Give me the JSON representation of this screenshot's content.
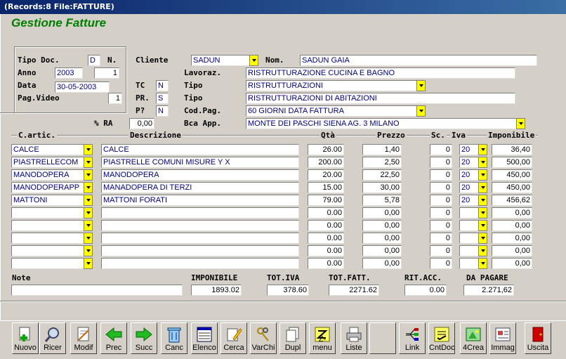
{
  "window": {
    "title": "(Records:8          File:FATTURE)"
  },
  "app_title": "Gestione Fatture",
  "header": {
    "tipo_doc_label": "Tipo Doc.",
    "tipo_doc_value": "D",
    "n_label": "N.",
    "anno_label": "Anno",
    "anno_value": "2003",
    "numero_value": "1",
    "data_label": "Data",
    "data_value": "30-05-2003",
    "pag_video_label": "Pag.Video",
    "pag_video_value": "1",
    "cliente_label": "Cliente",
    "cliente_value": "SADUN",
    "nom_label": "Nom.",
    "nom_value": "SADUN  GAIA",
    "lavoraz_label": "Lavoraz.",
    "lavoraz_value": "RISTRUTTURAZIONE CUCINA E BAGNO",
    "tc_label": "TC",
    "tc_value": "N",
    "tipo1_label": "Tipo",
    "tipo1_value": "RISTRUTTURAZIONI",
    "pr_label": "PR.",
    "pr_value": "S",
    "tipo2_label": "Tipo",
    "tipo2_value": "RISTRUTTURAZIONI DI ABITAZIONI",
    "p_label": "P?",
    "p_value": "N",
    "codpag_label": "Cod.Pag.",
    "codpag_value": "60 GIORNI DATA FATTURA",
    "ra_label": "% RA",
    "ra_value": "0,00",
    "bca_label": "Bca App.",
    "bca_value": "MONTE DEI PASCHI SIENA  AG. 3  MILANO"
  },
  "columns": {
    "cartic": "C.artic.",
    "descrizione": "Descrizione",
    "qta": "Qtà",
    "prezzo": "Prezzo",
    "sc": "Sc.",
    "iva": "Iva",
    "imponibile": "Imponibile"
  },
  "rows": [
    {
      "cod": "CALCE",
      "desc": "CALCE",
      "qta": "26.00",
      "prezzo": "1,40",
      "sc": "0",
      "iva": "20",
      "imp": "36,40"
    },
    {
      "cod": "PIASTRELLECOM",
      "desc": "PIASTRELLE COMUNI MISURE Y X",
      "qta": "200.00",
      "prezzo": "2,50",
      "sc": "0",
      "iva": "20",
      "imp": "500,00"
    },
    {
      "cod": "MANODOPERA",
      "desc": "MANODOPERA",
      "qta": "20.00",
      "prezzo": "22,50",
      "sc": "0",
      "iva": "20",
      "imp": "450,00"
    },
    {
      "cod": "MANODOPERAPP",
      "desc": "MANADOPERA DI TERZI",
      "qta": "15.00",
      "prezzo": "30,00",
      "sc": "0",
      "iva": "20",
      "imp": "450,00"
    },
    {
      "cod": "MATTONI",
      "desc": "MATTONI FORATI",
      "qta": "79.00",
      "prezzo": "5,78",
      "sc": "0",
      "iva": "20",
      "imp": "456,62"
    },
    {
      "cod": "",
      "desc": "",
      "qta": "0.00",
      "prezzo": "0,00",
      "sc": "0",
      "iva": "",
      "imp": "0,00"
    },
    {
      "cod": "",
      "desc": "",
      "qta": "0.00",
      "prezzo": "0,00",
      "sc": "0",
      "iva": "",
      "imp": "0,00"
    },
    {
      "cod": "",
      "desc": "",
      "qta": "0.00",
      "prezzo": "0,00",
      "sc": "0",
      "iva": "",
      "imp": "0,00"
    },
    {
      "cod": "",
      "desc": "",
      "qta": "0.00",
      "prezzo": "0,00",
      "sc": "0",
      "iva": "",
      "imp": "0,00"
    },
    {
      "cod": "",
      "desc": "",
      "qta": "0.00",
      "prezzo": "0,00",
      "sc": "0",
      "iva": "",
      "imp": "0,00"
    }
  ],
  "totals": {
    "note_label": "Note",
    "note_value": "",
    "imponibile_label": "IMPONIBILE",
    "imponibile_value": "1893.02",
    "totiva_label": "TOT.IVA",
    "totiva_value": "378.60",
    "totfatt_label": "TOT.FATT.",
    "totfatt_value": "2271.62",
    "ritacc_label": "RIT.ACC.",
    "ritacc_value": "0.00",
    "dapagare_label": "DA PAGARE",
    "dapagare_value": "2.271,62"
  },
  "toolbar": [
    {
      "label": "Nuovo",
      "icon": "new-document-icon"
    },
    {
      "label": "Ricer",
      "icon": "search-icon"
    },
    {
      "label": "Modif",
      "icon": "edit-icon"
    },
    {
      "label": "Prec",
      "icon": "arrow-left-icon"
    },
    {
      "label": "Succ",
      "icon": "arrow-right-icon"
    },
    {
      "label": "Canc",
      "icon": "trash-icon"
    },
    {
      "label": "Elenco",
      "icon": "list-icon"
    },
    {
      "label": "Cerca",
      "icon": "find-icon"
    },
    {
      "label": "VarChi",
      "icon": "keys-icon"
    },
    {
      "label": "Dupl",
      "icon": "duplicate-icon"
    },
    {
      "label": "Z-menu",
      "icon": "zmenu-icon"
    },
    {
      "label": "Liste",
      "icon": "printer-icon"
    },
    {
      "label": "Link",
      "icon": "link-icon"
    },
    {
      "label": "CntDoc",
      "icon": "count-doc-icon"
    },
    {
      "label": "4Crea",
      "icon": "create-icon"
    },
    {
      "label": "Immag",
      "icon": "image-icon"
    },
    {
      "label": "Uscita",
      "icon": "exit-icon"
    }
  ],
  "colors": {
    "title_green": "#008000",
    "field_text": "#000080",
    "dropdown": "#ffff00",
    "titlebar": "#0a246a"
  }
}
